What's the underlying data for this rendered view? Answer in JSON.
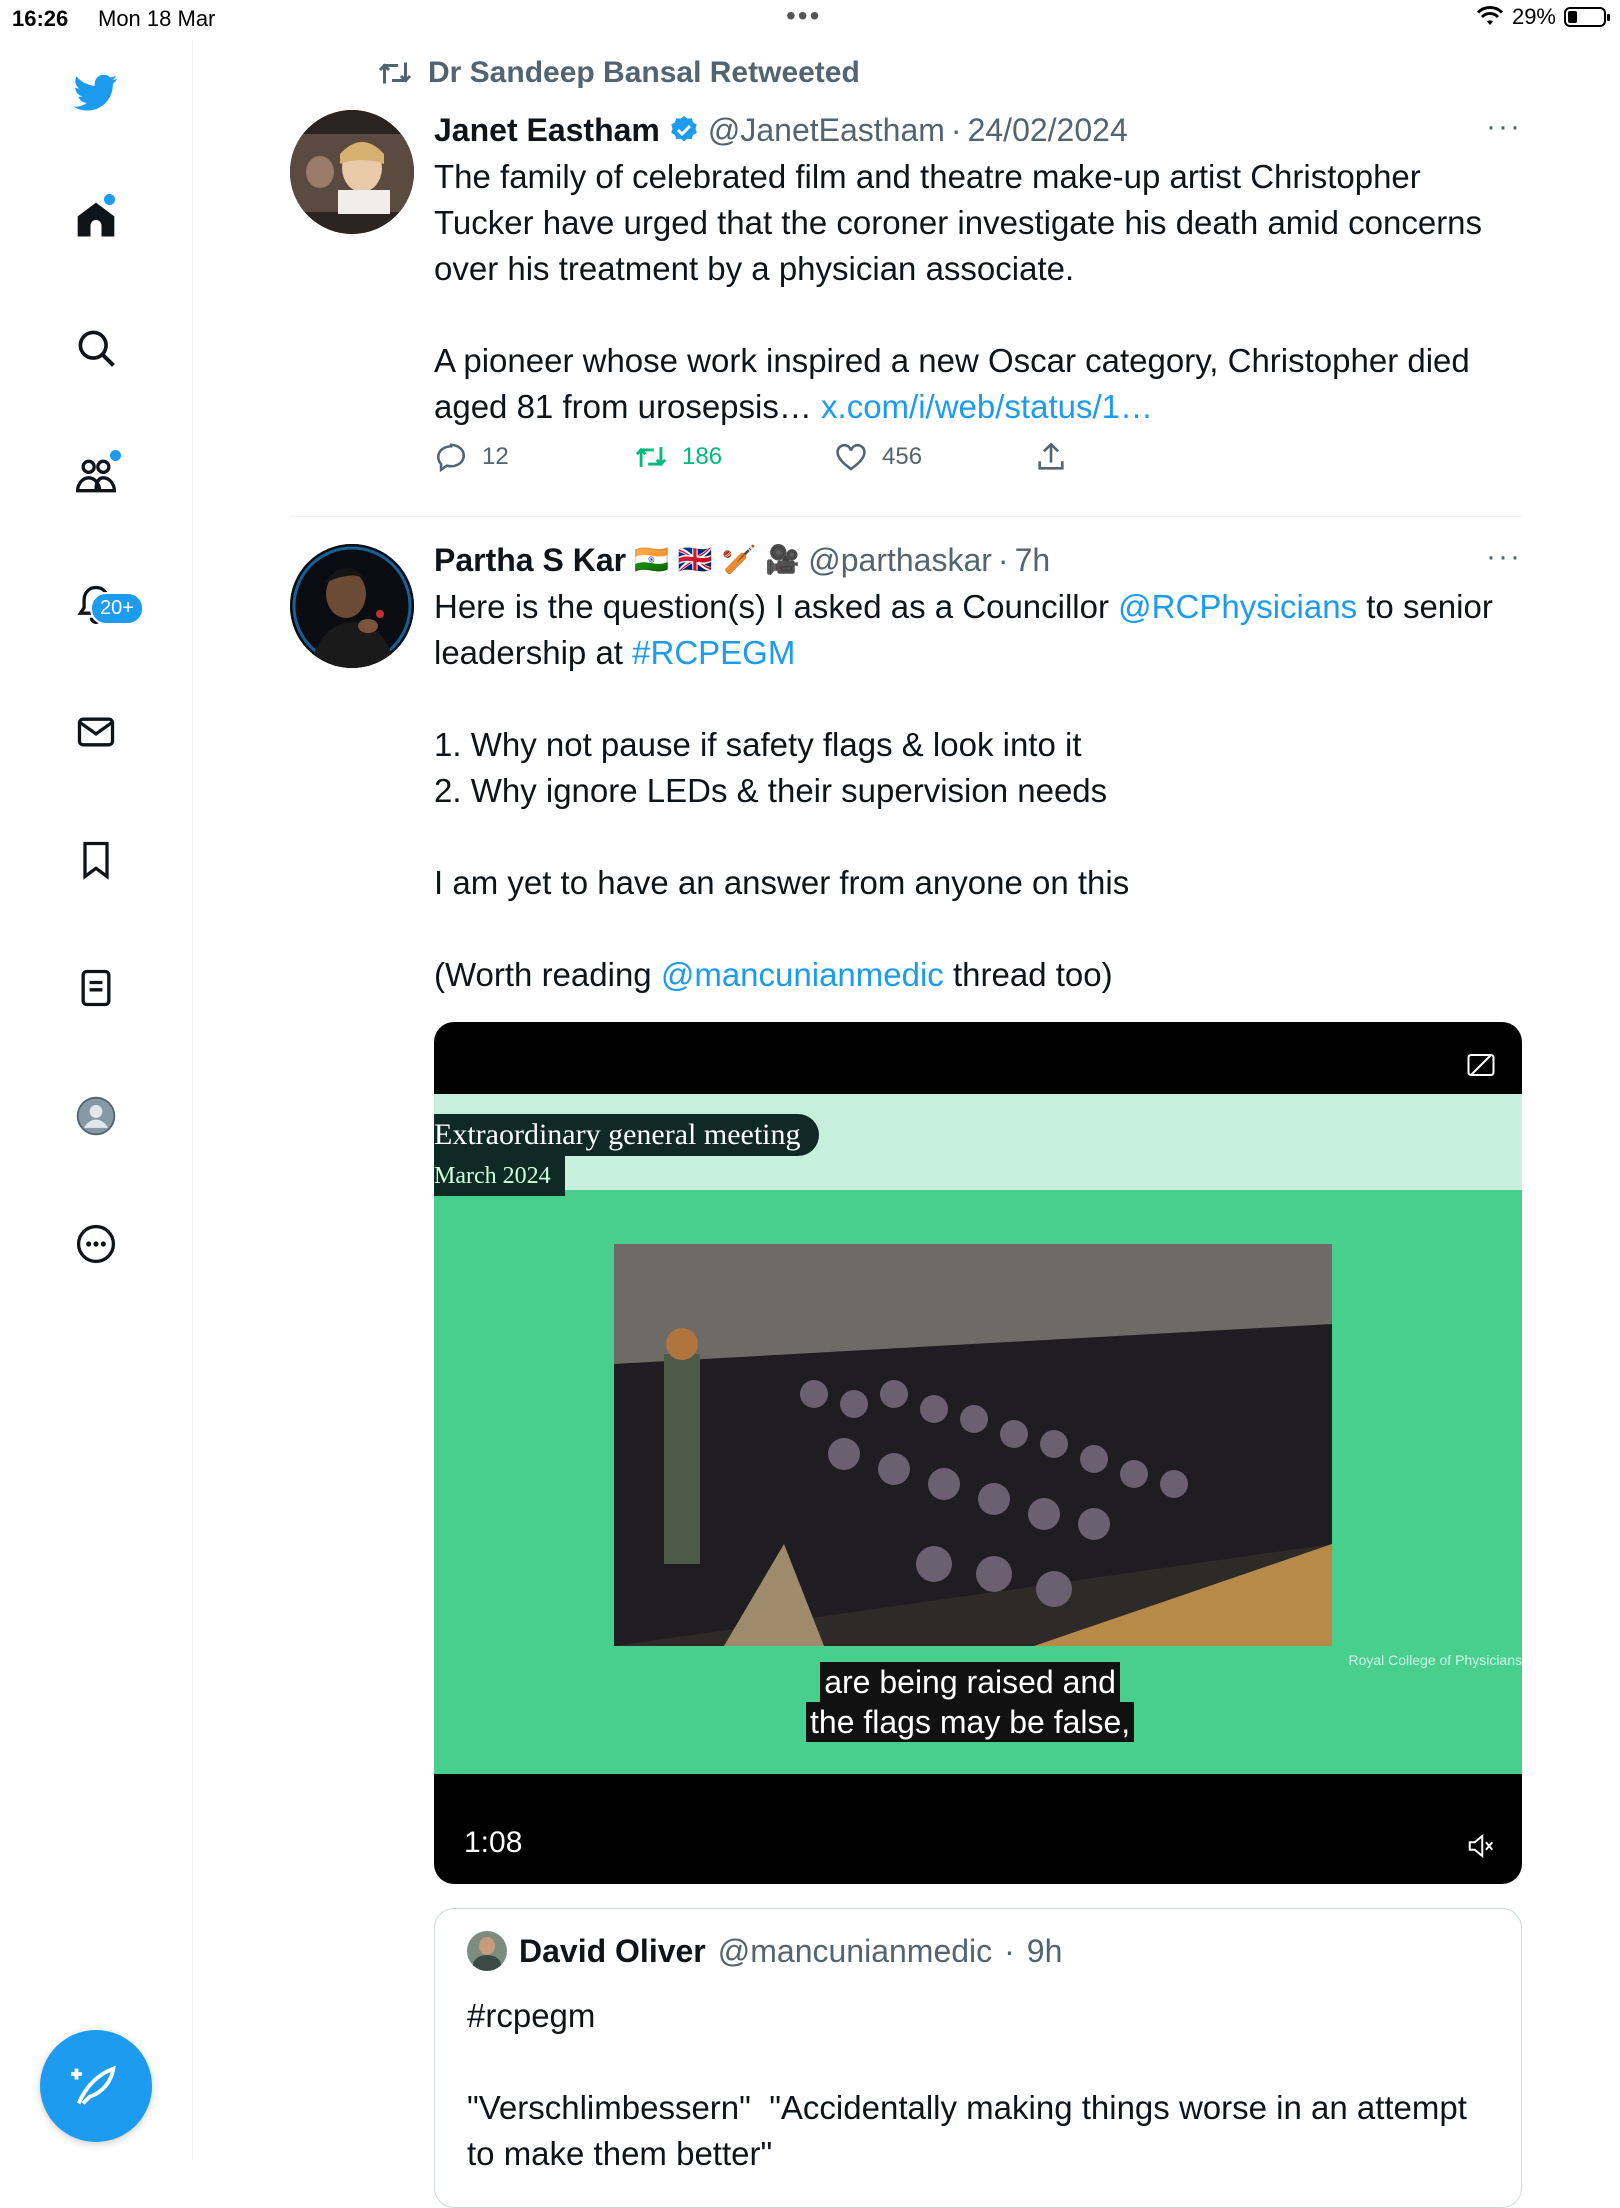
{
  "status_bar": {
    "time": "16:26",
    "date": "Mon 18 Mar",
    "dots": "•••",
    "battery": "29%"
  },
  "sidebar": {
    "notifications_badge": "20+"
  },
  "retweet_line": "Dr Sandeep Bansal Retweeted",
  "tweet1": {
    "name": "Janet Eastham",
    "handle": "@JanetEastham",
    "sep": "·",
    "date": "24/02/2024",
    "more": "···",
    "para1": "The family of celebrated film and theatre make-up artist Christopher Tucker have urged that the coroner investigate his death amid concerns over his treatment by a physician associate.",
    "para2": "A pioneer whose work inspired a new Oscar category, Christopher died aged 81 from urosepsis…",
    "link": "x.com/i/web/status/1…",
    "replies": "12",
    "retweets": "186",
    "likes": "456"
  },
  "tweet2": {
    "name": "Partha S Kar",
    "flags": "🇮🇳 🇬🇧 🏏 🎥",
    "handle": "@parthaskar",
    "sep": "·",
    "time": "7h",
    "more": "···",
    "line1_a": "Here is the question(s) I asked as a Councillor",
    "mention1": "@RCPhysicians",
    "line1_b": "to senior leadership at",
    "hashtag": "#RCPEGM",
    "q1": "1. Why not pause if safety flags & look into it",
    "q2": "2. Why ignore LEDs & their supervision needs",
    "answer": "I am yet to have an answer from anyone on this",
    "worth_a": "(Worth reading",
    "mention2": "@mancunianmedic",
    "worth_b": "thread too)",
    "video": {
      "banner_title": "Extraordinary general meeting",
      "banner_sub": "March 2024",
      "caption1": "are being raised and",
      "caption2": "the flags may be false,",
      "logo": "Royal College of Physicians",
      "duration": "1:08"
    },
    "quote": {
      "name": "David Oliver",
      "handle": "@mancunianmedic",
      "sep": "·",
      "time": "9h",
      "text": "#rcpegm\n\n\"Verschlimbessern\"  \"Accidentally making things worse in an attempt to make them better\""
    }
  }
}
